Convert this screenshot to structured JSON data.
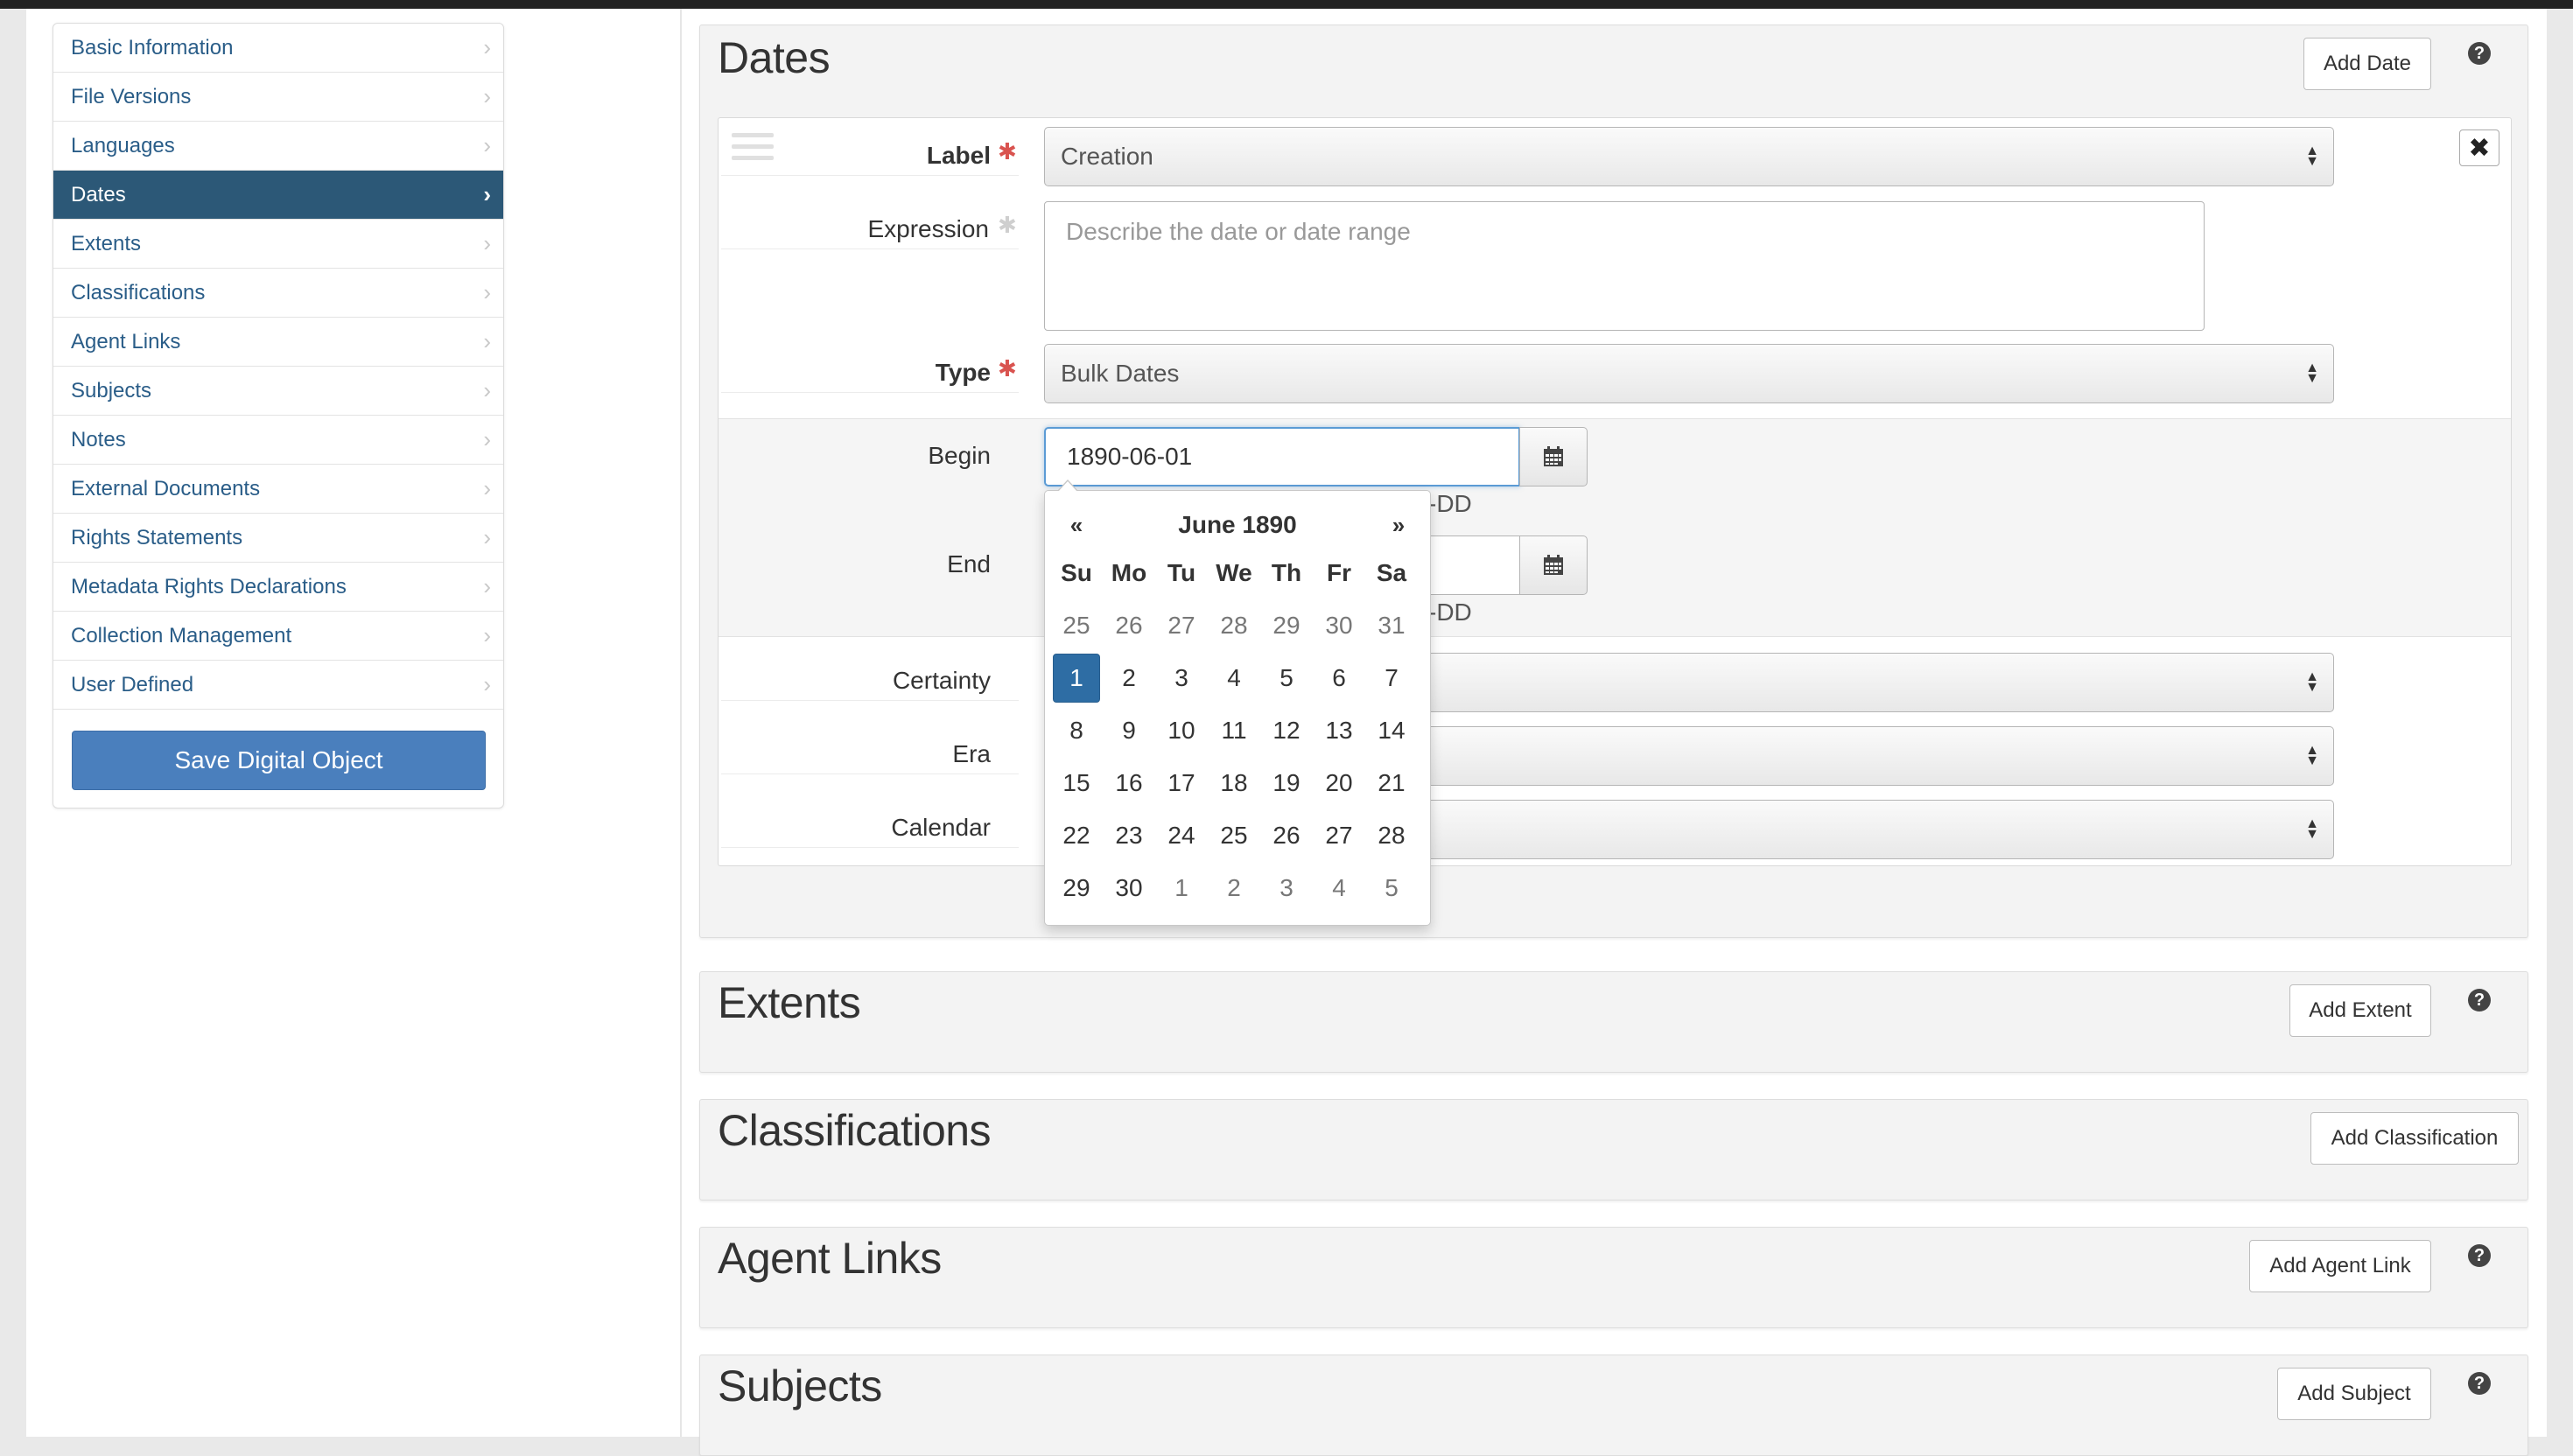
{
  "sidebar": {
    "items": [
      {
        "label": "Basic Information"
      },
      {
        "label": "File Versions"
      },
      {
        "label": "Languages"
      },
      {
        "label": "Dates"
      },
      {
        "label": "Extents"
      },
      {
        "label": "Classifications"
      },
      {
        "label": "Agent Links"
      },
      {
        "label": "Subjects"
      },
      {
        "label": "Notes"
      },
      {
        "label": "External Documents"
      },
      {
        "label": "Rights Statements"
      },
      {
        "label": "Metadata Rights Declarations"
      },
      {
        "label": "Collection Management"
      },
      {
        "label": "User Defined"
      }
    ],
    "active_index": 3,
    "save_label": "Save Digital Object"
  },
  "dates": {
    "title": "Dates",
    "add_label": "Add Date",
    "help": "?",
    "close": "✖",
    "label_field": {
      "label": "Label",
      "value": "Creation"
    },
    "expression_field": {
      "label": "Expression",
      "placeholder": "Describe the date or date range"
    },
    "type_field": {
      "label": "Type",
      "value": "Bulk Dates"
    },
    "begin_field": {
      "label": "Begin",
      "value": "1890-06-01",
      "hint": "-DD"
    },
    "end_field": {
      "label": "End",
      "value": "",
      "hint": "-DD"
    },
    "certainty_field": {
      "label": "Certainty",
      "value": ""
    },
    "era_field": {
      "label": "Era",
      "value": ""
    },
    "calendar_field": {
      "label": "Calendar",
      "value": ""
    }
  },
  "datepicker": {
    "prev": "«",
    "next": "»",
    "month_title": "June 1890",
    "weekdays": [
      "Su",
      "Mo",
      "Tu",
      "We",
      "Th",
      "Fr",
      "Sa"
    ],
    "weeks": [
      [
        "25",
        "26",
        "27",
        "28",
        "29",
        "30",
        "31"
      ],
      [
        "1",
        "2",
        "3",
        "4",
        "5",
        "6",
        "7"
      ],
      [
        "8",
        "9",
        "10",
        "11",
        "12",
        "13",
        "14"
      ],
      [
        "15",
        "16",
        "17",
        "18",
        "19",
        "20",
        "21"
      ],
      [
        "22",
        "23",
        "24",
        "25",
        "26",
        "27",
        "28"
      ],
      [
        "29",
        "30",
        "1",
        "2",
        "3",
        "4",
        "5"
      ]
    ],
    "selected": "1"
  },
  "extents": {
    "title": "Extents",
    "add_label": "Add Extent",
    "help": "?"
  },
  "classifications": {
    "title": "Classifications",
    "add_label": "Add Classification"
  },
  "agent_links": {
    "title": "Agent Links",
    "add_label": "Add Agent Link",
    "help": "?"
  },
  "subjects": {
    "title": "Subjects",
    "add_label": "Add Subject",
    "help": "?"
  }
}
